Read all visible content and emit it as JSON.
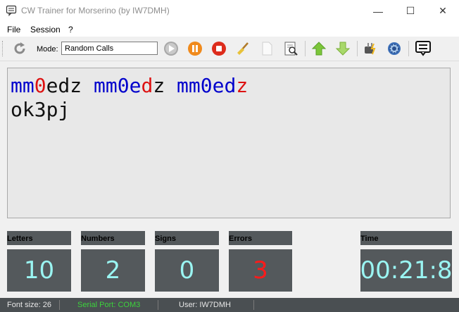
{
  "window": {
    "title": "CW Trainer for Morserino (by IW7DMH)",
    "minimize": "—",
    "maximize": "☐",
    "close": "✕"
  },
  "menu": {
    "items": [
      "File",
      "Session",
      "?"
    ]
  },
  "toolbar": {
    "mode_label": "Mode:",
    "mode_value": "Random Calls"
  },
  "text_output": {
    "line1": [
      {
        "t": "mm",
        "c": "blue"
      },
      {
        "t": "0",
        "c": "red"
      },
      {
        "t": "edz ",
        "c": "black"
      },
      {
        "t": "mm0e",
        "c": "blue"
      },
      {
        "t": "d",
        "c": "red"
      },
      {
        "t": "z ",
        "c": "black"
      },
      {
        "t": "mm0ed",
        "c": "blue"
      },
      {
        "t": "z",
        "c": "red"
      }
    ],
    "line2": [
      {
        "t": "ok3pj",
        "c": "black"
      }
    ]
  },
  "stats": {
    "letters": {
      "label": "Letters",
      "value": "10"
    },
    "numbers": {
      "label": "Numbers",
      "value": "2"
    },
    "signs": {
      "label": "Signs",
      "value": "0"
    },
    "errors": {
      "label": "Errors",
      "value": "3"
    },
    "time": {
      "label": "Time",
      "value": "00:21:8"
    }
  },
  "colors": {
    "stat_value": "#9af5f2",
    "error_value": "#ff1a1a",
    "serial_port": "#3cd33c"
  },
  "statusbar": {
    "font_size": "Font size: 26",
    "serial_port": "Serial Port: COM3",
    "user": "User: IW7DMH"
  }
}
